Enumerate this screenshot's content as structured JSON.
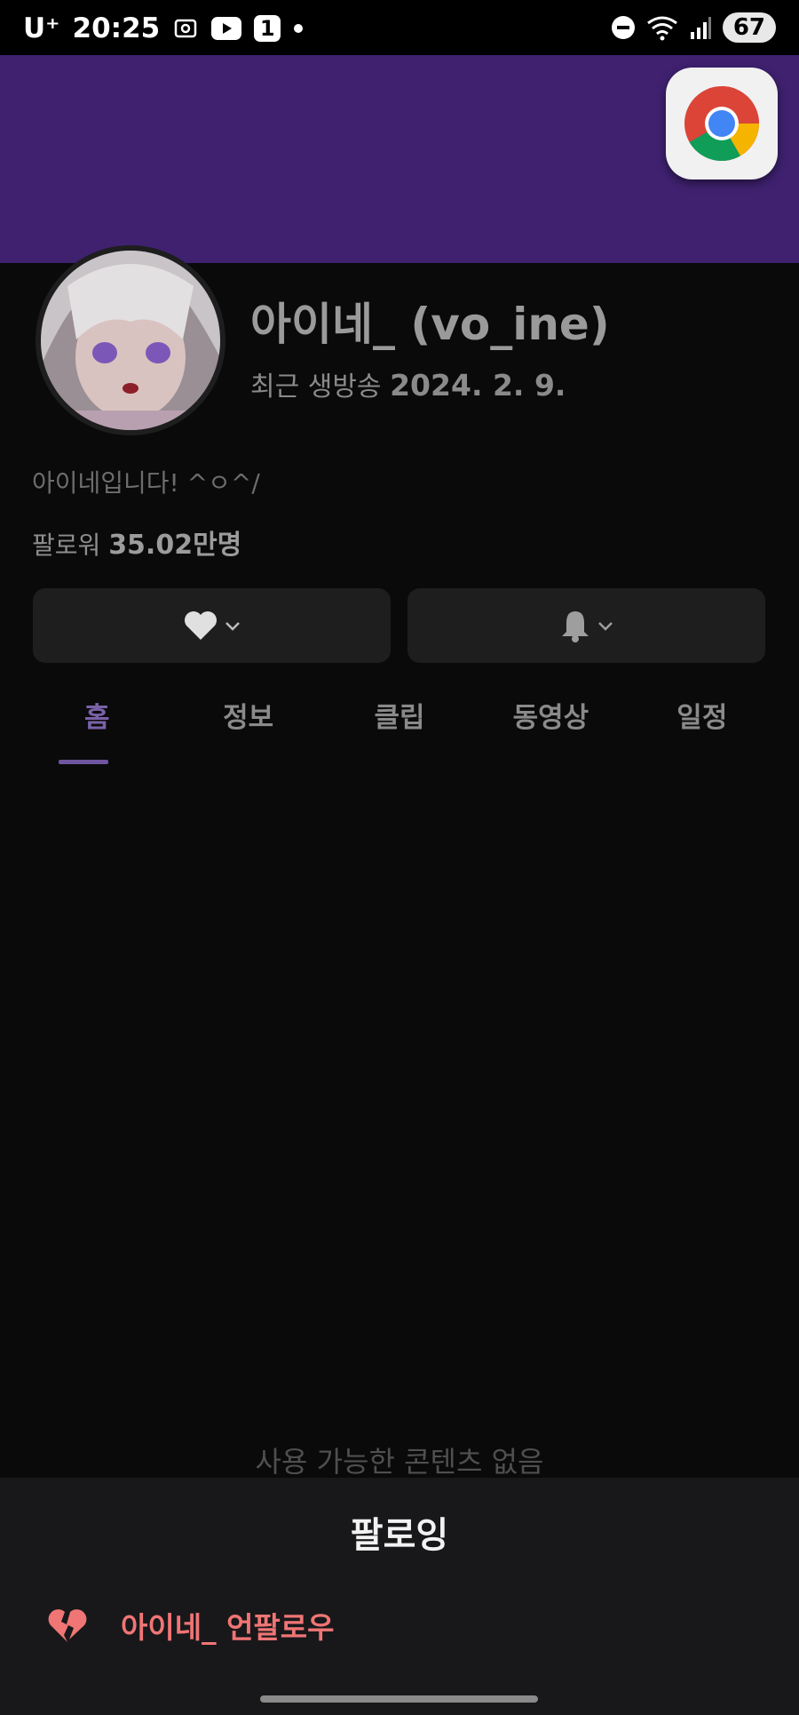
{
  "status_bar": {
    "carrier": "U⁺",
    "time": "20:25",
    "notification_count": "1",
    "battery": "67"
  },
  "profile": {
    "name": "아이네_ (vo_ine)",
    "last_live_label": "최근 생방송",
    "last_live_date": "2024. 2. 9.",
    "bio": "아이네입니다! ^ㅇ^/",
    "followers_label": "팔로워",
    "followers_count": "35.02만명"
  },
  "tabs": [
    {
      "label": "홈",
      "active": true
    },
    {
      "label": "정보"
    },
    {
      "label": "클립"
    },
    {
      "label": "동영상"
    },
    {
      "label": "일정"
    }
  ],
  "empty_state": "사용 가능한 콘텐츠 없음",
  "sheet": {
    "title": "팔로잉",
    "unfollow_label": "아이네_ 언팔로우"
  },
  "colors": {
    "banner": "#3f2170",
    "accent": "#7a62a8",
    "unfollow": "#f07575"
  }
}
